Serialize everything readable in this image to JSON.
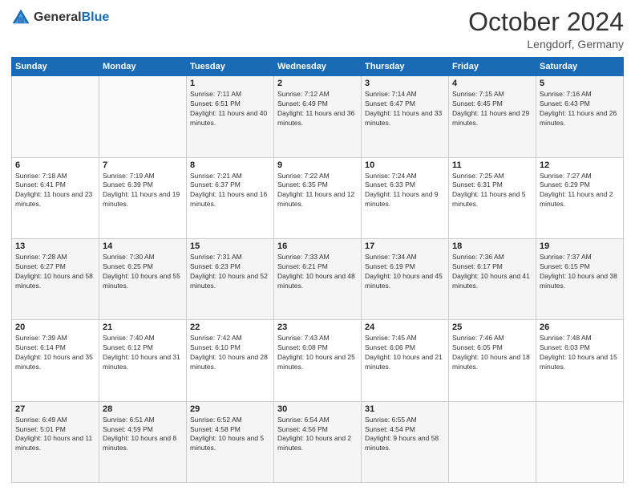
{
  "header": {
    "logo_general": "General",
    "logo_blue": "Blue",
    "title": "October 2024",
    "subtitle": "Lengdorf, Germany"
  },
  "days_of_week": [
    "Sunday",
    "Monday",
    "Tuesday",
    "Wednesday",
    "Thursday",
    "Friday",
    "Saturday"
  ],
  "weeks": [
    [
      {
        "day": "",
        "sunrise": "",
        "sunset": "",
        "daylight": ""
      },
      {
        "day": "",
        "sunrise": "",
        "sunset": "",
        "daylight": ""
      },
      {
        "day": "1",
        "sunrise": "Sunrise: 7:11 AM",
        "sunset": "Sunset: 6:51 PM",
        "daylight": "Daylight: 11 hours and 40 minutes."
      },
      {
        "day": "2",
        "sunrise": "Sunrise: 7:12 AM",
        "sunset": "Sunset: 6:49 PM",
        "daylight": "Daylight: 11 hours and 36 minutes."
      },
      {
        "day": "3",
        "sunrise": "Sunrise: 7:14 AM",
        "sunset": "Sunset: 6:47 PM",
        "daylight": "Daylight: 11 hours and 33 minutes."
      },
      {
        "day": "4",
        "sunrise": "Sunrise: 7:15 AM",
        "sunset": "Sunset: 6:45 PM",
        "daylight": "Daylight: 11 hours and 29 minutes."
      },
      {
        "day": "5",
        "sunrise": "Sunrise: 7:16 AM",
        "sunset": "Sunset: 6:43 PM",
        "daylight": "Daylight: 11 hours and 26 minutes."
      }
    ],
    [
      {
        "day": "6",
        "sunrise": "Sunrise: 7:18 AM",
        "sunset": "Sunset: 6:41 PM",
        "daylight": "Daylight: 11 hours and 23 minutes."
      },
      {
        "day": "7",
        "sunrise": "Sunrise: 7:19 AM",
        "sunset": "Sunset: 6:39 PM",
        "daylight": "Daylight: 11 hours and 19 minutes."
      },
      {
        "day": "8",
        "sunrise": "Sunrise: 7:21 AM",
        "sunset": "Sunset: 6:37 PM",
        "daylight": "Daylight: 11 hours and 16 minutes."
      },
      {
        "day": "9",
        "sunrise": "Sunrise: 7:22 AM",
        "sunset": "Sunset: 6:35 PM",
        "daylight": "Daylight: 11 hours and 12 minutes."
      },
      {
        "day": "10",
        "sunrise": "Sunrise: 7:24 AM",
        "sunset": "Sunset: 6:33 PM",
        "daylight": "Daylight: 11 hours and 9 minutes."
      },
      {
        "day": "11",
        "sunrise": "Sunrise: 7:25 AM",
        "sunset": "Sunset: 6:31 PM",
        "daylight": "Daylight: 11 hours and 5 minutes."
      },
      {
        "day": "12",
        "sunrise": "Sunrise: 7:27 AM",
        "sunset": "Sunset: 6:29 PM",
        "daylight": "Daylight: 11 hours and 2 minutes."
      }
    ],
    [
      {
        "day": "13",
        "sunrise": "Sunrise: 7:28 AM",
        "sunset": "Sunset: 6:27 PM",
        "daylight": "Daylight: 10 hours and 58 minutes."
      },
      {
        "day": "14",
        "sunrise": "Sunrise: 7:30 AM",
        "sunset": "Sunset: 6:25 PM",
        "daylight": "Daylight: 10 hours and 55 minutes."
      },
      {
        "day": "15",
        "sunrise": "Sunrise: 7:31 AM",
        "sunset": "Sunset: 6:23 PM",
        "daylight": "Daylight: 10 hours and 52 minutes."
      },
      {
        "day": "16",
        "sunrise": "Sunrise: 7:33 AM",
        "sunset": "Sunset: 6:21 PM",
        "daylight": "Daylight: 10 hours and 48 minutes."
      },
      {
        "day": "17",
        "sunrise": "Sunrise: 7:34 AM",
        "sunset": "Sunset: 6:19 PM",
        "daylight": "Daylight: 10 hours and 45 minutes."
      },
      {
        "day": "18",
        "sunrise": "Sunrise: 7:36 AM",
        "sunset": "Sunset: 6:17 PM",
        "daylight": "Daylight: 10 hours and 41 minutes."
      },
      {
        "day": "19",
        "sunrise": "Sunrise: 7:37 AM",
        "sunset": "Sunset: 6:15 PM",
        "daylight": "Daylight: 10 hours and 38 minutes."
      }
    ],
    [
      {
        "day": "20",
        "sunrise": "Sunrise: 7:39 AM",
        "sunset": "Sunset: 6:14 PM",
        "daylight": "Daylight: 10 hours and 35 minutes."
      },
      {
        "day": "21",
        "sunrise": "Sunrise: 7:40 AM",
        "sunset": "Sunset: 6:12 PM",
        "daylight": "Daylight: 10 hours and 31 minutes."
      },
      {
        "day": "22",
        "sunrise": "Sunrise: 7:42 AM",
        "sunset": "Sunset: 6:10 PM",
        "daylight": "Daylight: 10 hours and 28 minutes."
      },
      {
        "day": "23",
        "sunrise": "Sunrise: 7:43 AM",
        "sunset": "Sunset: 6:08 PM",
        "daylight": "Daylight: 10 hours and 25 minutes."
      },
      {
        "day": "24",
        "sunrise": "Sunrise: 7:45 AM",
        "sunset": "Sunset: 6:06 PM",
        "daylight": "Daylight: 10 hours and 21 minutes."
      },
      {
        "day": "25",
        "sunrise": "Sunrise: 7:46 AM",
        "sunset": "Sunset: 6:05 PM",
        "daylight": "Daylight: 10 hours and 18 minutes."
      },
      {
        "day": "26",
        "sunrise": "Sunrise: 7:48 AM",
        "sunset": "Sunset: 6:03 PM",
        "daylight": "Daylight: 10 hours and 15 minutes."
      }
    ],
    [
      {
        "day": "27",
        "sunrise": "Sunrise: 6:49 AM",
        "sunset": "Sunset: 5:01 PM",
        "daylight": "Daylight: 10 hours and 11 minutes."
      },
      {
        "day": "28",
        "sunrise": "Sunrise: 6:51 AM",
        "sunset": "Sunset: 4:59 PM",
        "daylight": "Daylight: 10 hours and 8 minutes."
      },
      {
        "day": "29",
        "sunrise": "Sunrise: 6:52 AM",
        "sunset": "Sunset: 4:58 PM",
        "daylight": "Daylight: 10 hours and 5 minutes."
      },
      {
        "day": "30",
        "sunrise": "Sunrise: 6:54 AM",
        "sunset": "Sunset: 4:56 PM",
        "daylight": "Daylight: 10 hours and 2 minutes."
      },
      {
        "day": "31",
        "sunrise": "Sunrise: 6:55 AM",
        "sunset": "Sunset: 4:54 PM",
        "daylight": "Daylight: 9 hours and 58 minutes."
      },
      {
        "day": "",
        "sunrise": "",
        "sunset": "",
        "daylight": ""
      },
      {
        "day": "",
        "sunrise": "",
        "sunset": "",
        "daylight": ""
      }
    ]
  ]
}
